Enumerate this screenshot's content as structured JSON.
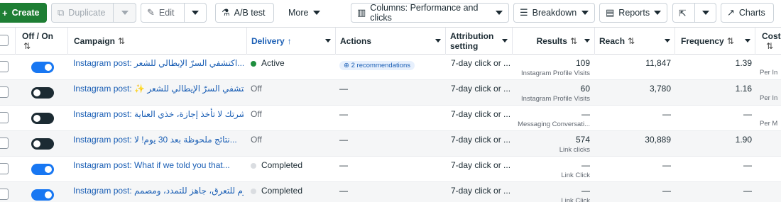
{
  "toolbar": {
    "create": "Create",
    "duplicate": "Duplicate",
    "edit": "Edit",
    "ab_test": "A/B test",
    "more": "More",
    "columns": "Columns: Performance and clicks",
    "breakdown": "Breakdown",
    "reports": "Reports",
    "charts": "Charts"
  },
  "headers": {
    "off_on": "Off / On",
    "campaign": "Campaign",
    "delivery": "Delivery",
    "actions": "Actions",
    "attribution": "Attribution setting",
    "results": "Results",
    "reach": "Reach",
    "frequency": "Frequency",
    "cost": "Cost"
  },
  "rows": [
    {
      "toggle": "on",
      "campaign": "Instagram post: اكتشفي السرّ الإيطالي للشعر...",
      "delivery": "Active",
      "delivery_color": "#1e8e3e",
      "action": "2 recommendations",
      "attribution": "7-day click or ...",
      "results": "109",
      "results_sub": "Instagram Profile Visits",
      "reach": "11,847",
      "frequency": "1.39",
      "cost_sub": "Per In"
    },
    {
      "toggle": "off",
      "campaign": "Instagram post: ✨ اكتشفي السرّ الإيطالي للشعر...",
      "delivery": "Off",
      "delivery_color": "",
      "action": "—",
      "attribution": "7-day click or ...",
      "results": "60",
      "results_sub": "Instagram Profile Visits",
      "reach": "3,780",
      "frequency": "1.16",
      "cost_sub": "Per In"
    },
    {
      "toggle": "off",
      "campaign": "Instagram post: بشرتك لا تأخذ إجازة، خذي العناية...",
      "delivery": "Off",
      "delivery_color": "",
      "action": "—",
      "attribution": "7-day click or ...",
      "results": "—",
      "results_sub": "Messaging Conversati...",
      "reach": "—",
      "frequency": "—",
      "cost_sub": "Per M"
    },
    {
      "toggle": "off",
      "campaign": "Instagram post: نتائج ملحوظة بعد 30 يوم! لا...",
      "delivery": "Off",
      "delivery_color": "",
      "action": "—",
      "attribution": "7-day click or ...",
      "results": "574",
      "results_sub": "Link clicks",
      "reach": "30,889",
      "frequency": "1.90",
      "cost_sub": ""
    },
    {
      "toggle": "on",
      "campaign": "Instagram post: What if we told you that...",
      "delivery": "Completed",
      "delivery_color": "#dadde1",
      "action": "—",
      "attribution": "7-day click or ...",
      "results": "—",
      "results_sub": "Link Click",
      "reach": "—",
      "frequency": "—",
      "cost_sub": ""
    },
    {
      "toggle": "on",
      "campaign": "Instagram post: ساوم للتعرق، جاهز للتمدد، ومصمم...",
      "delivery": "Completed",
      "delivery_color": "#dadde1",
      "action": "—",
      "attribution": "7-day click or ...",
      "results": "—",
      "results_sub": "Link Click",
      "reach": "—",
      "frequency": "—",
      "cost_sub": ""
    }
  ]
}
